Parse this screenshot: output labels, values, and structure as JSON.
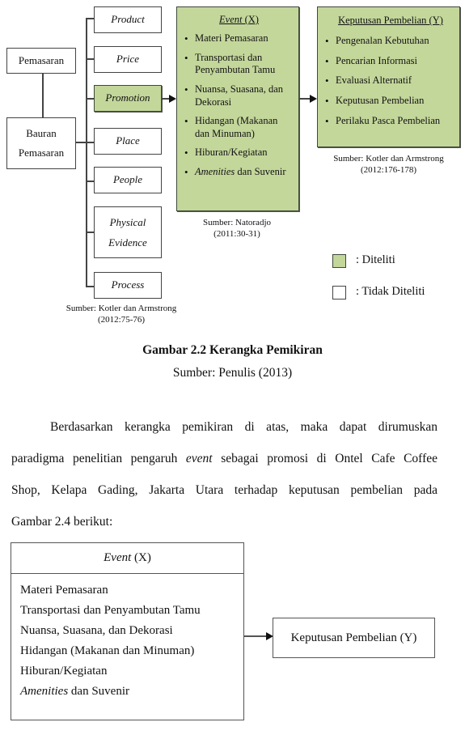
{
  "diagram": {
    "root": "Pemasaran",
    "mix_box": [
      "Bauran",
      "Pemasaran"
    ],
    "mix_items": [
      {
        "label": "Product",
        "researched": false
      },
      {
        "label": "Price",
        "researched": false
      },
      {
        "label": "Promotion",
        "researched": true
      },
      {
        "label": "Place",
        "researched": false
      },
      {
        "label": "People",
        "researched": false
      },
      {
        "label": "Physical Evidence",
        "lines": [
          "Physical",
          "Evidence"
        ],
        "researched": false
      },
      {
        "label": "Process",
        "researched": false
      }
    ],
    "mix_source": [
      "Sumber: Kotler dan Armstrong",
      "(2012:75-76)"
    ],
    "event_panel": {
      "title_italic": "Event",
      "title_rest": " (X)",
      "items": [
        {
          "text": "Materi Pemasaran"
        },
        {
          "text": "Transportasi dan Penyambutan Tamu"
        },
        {
          "text": "Nuansa, Suasana, dan Dekorasi"
        },
        {
          "text": "Hidangan (Makanan dan Minuman)"
        },
        {
          "text": "Hiburan/Kegiatan"
        },
        {
          "italic": "Amenities",
          "text": " dan Suvenir"
        }
      ],
      "source": [
        "Sumber: Natoradjo",
        "(2011:30-31)"
      ]
    },
    "decision_panel": {
      "title": "Keputusan Pembelian (Y)",
      "items": [
        "Pengenalan Kebutuhan",
        "Pencarian Informasi",
        "Evaluasi Alternatif",
        "Keputusan Pembelian",
        "Perilaku Pasca Pembelian"
      ],
      "source": [
        "Sumber: Kotler dan Armstrong",
        "(2012:176-178)"
      ]
    },
    "legend": [
      {
        "label": ": Diteliti",
        "color": "#c4d79b"
      },
      {
        "label": ": Tidak Diteliti",
        "color": "#ffffff"
      }
    ]
  },
  "figure_caption": {
    "title": "Gambar 2.2 Kerangka Pemikiran",
    "source": "Sumber: Penulis (2013)"
  },
  "paragraph": {
    "lines": [
      {
        "parts": [
          {
            "t": "Berdasarkan kerangka pemikiran di atas, maka dapat dirumuskan"
          }
        ]
      },
      {
        "parts": [
          {
            "t": "paradigma penelitian pengaruh "
          },
          {
            "t": "event",
            "i": true
          },
          {
            "t": " sebagai promosi di Ontel Cafe Coffee"
          }
        ]
      },
      {
        "parts": [
          {
            "t": "Shop, Kelapa Gading, Jakarta Utara terhadap keputusan pembelian pada"
          }
        ]
      },
      {
        "parts": [
          {
            "t": "Gambar 2.4 berikut:"
          }
        ]
      }
    ]
  },
  "paradigm": {
    "x_box": {
      "title_italic": "Event",
      "title_rest": " (X)",
      "items": [
        {
          "text": "Materi Pemasaran"
        },
        {
          "text": "Transportasi dan Penyambutan Tamu"
        },
        {
          "text": "Nuansa, Suasana, dan Dekorasi"
        },
        {
          "text": "Hidangan (Makanan dan Minuman)"
        },
        {
          "text": "Hiburan/Kegiatan"
        },
        {
          "italic": "Amenities",
          "text": " dan Suvenir"
        }
      ]
    },
    "y_box": "Keputusan Pembelian (Y)"
  },
  "colors": {
    "researched_fill": "#c4d79b",
    "not_researched_fill": "#ffffff",
    "line": "#444444"
  }
}
